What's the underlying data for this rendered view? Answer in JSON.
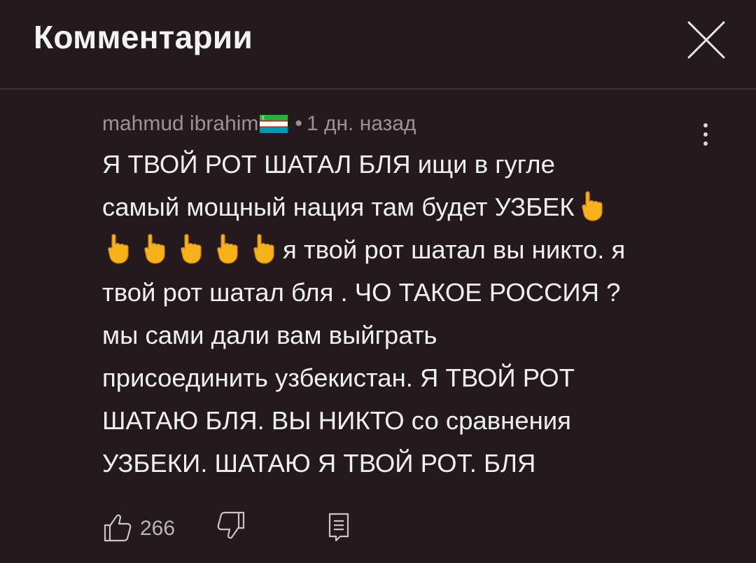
{
  "header": {
    "title": "Комментарии",
    "close_icon": "close-icon"
  },
  "comment": {
    "author": "mahmud ibrahim",
    "flag_icon": "uzbekistan-flag-icon",
    "separator": "•",
    "time": "1 дн. назад",
    "lines": [
      "Я ТВОЙ РОТ ШАТАЛ БЛЯ ищи в гугле",
      "самый мощный нация там будет УЗБЕК",
      "я твой рот шатал вы никто. я",
      "твой рот шатал бля . ЧО ТАКОЕ РОССИЯ ?",
      "мы сами дали вам выйграть",
      "присоединить узбекистан. Я ТВОЙ РОТ",
      "ШАТАЮ БЛЯ. ВЫ НИКТО со сравнения",
      "УЗБЕКИ. ШАТАЮ Я ТВОЙ РОТ. БЛЯ"
    ],
    "emoji_icon": "pointing-down-hand-emoji",
    "like_count": "266",
    "colors": {
      "background": "#241a1e",
      "text": "#f0f0f0",
      "meta": "#9a9396",
      "emoji": "#f6b21b"
    }
  }
}
